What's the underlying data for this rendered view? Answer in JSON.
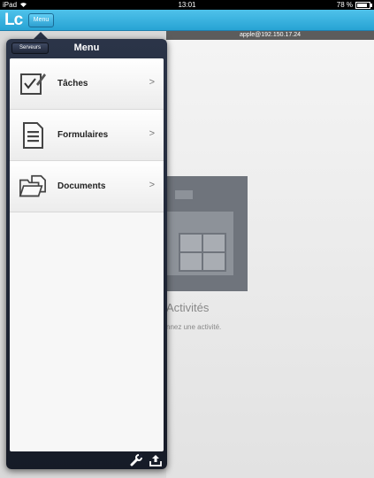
{
  "status_bar": {
    "device": "iPad",
    "time": "13:01",
    "battery": "78 %"
  },
  "app_bar": {
    "logo": "Lc",
    "menu_button": "Menu"
  },
  "server_bar": {
    "text": "apple@192.150.17.24"
  },
  "main": {
    "title": "Activités",
    "subtitle": "nnez une activité."
  },
  "popover": {
    "servers_button": "Serveurs",
    "title": "Menu",
    "items": [
      {
        "label": "Tâches",
        "icon": "tasks-icon"
      },
      {
        "label": "Formulaires",
        "icon": "forms-icon"
      },
      {
        "label": "Documents",
        "icon": "documents-icon"
      }
    ],
    "chevron": ">",
    "footer_icons": [
      "wrench-icon",
      "upload-icon"
    ]
  }
}
